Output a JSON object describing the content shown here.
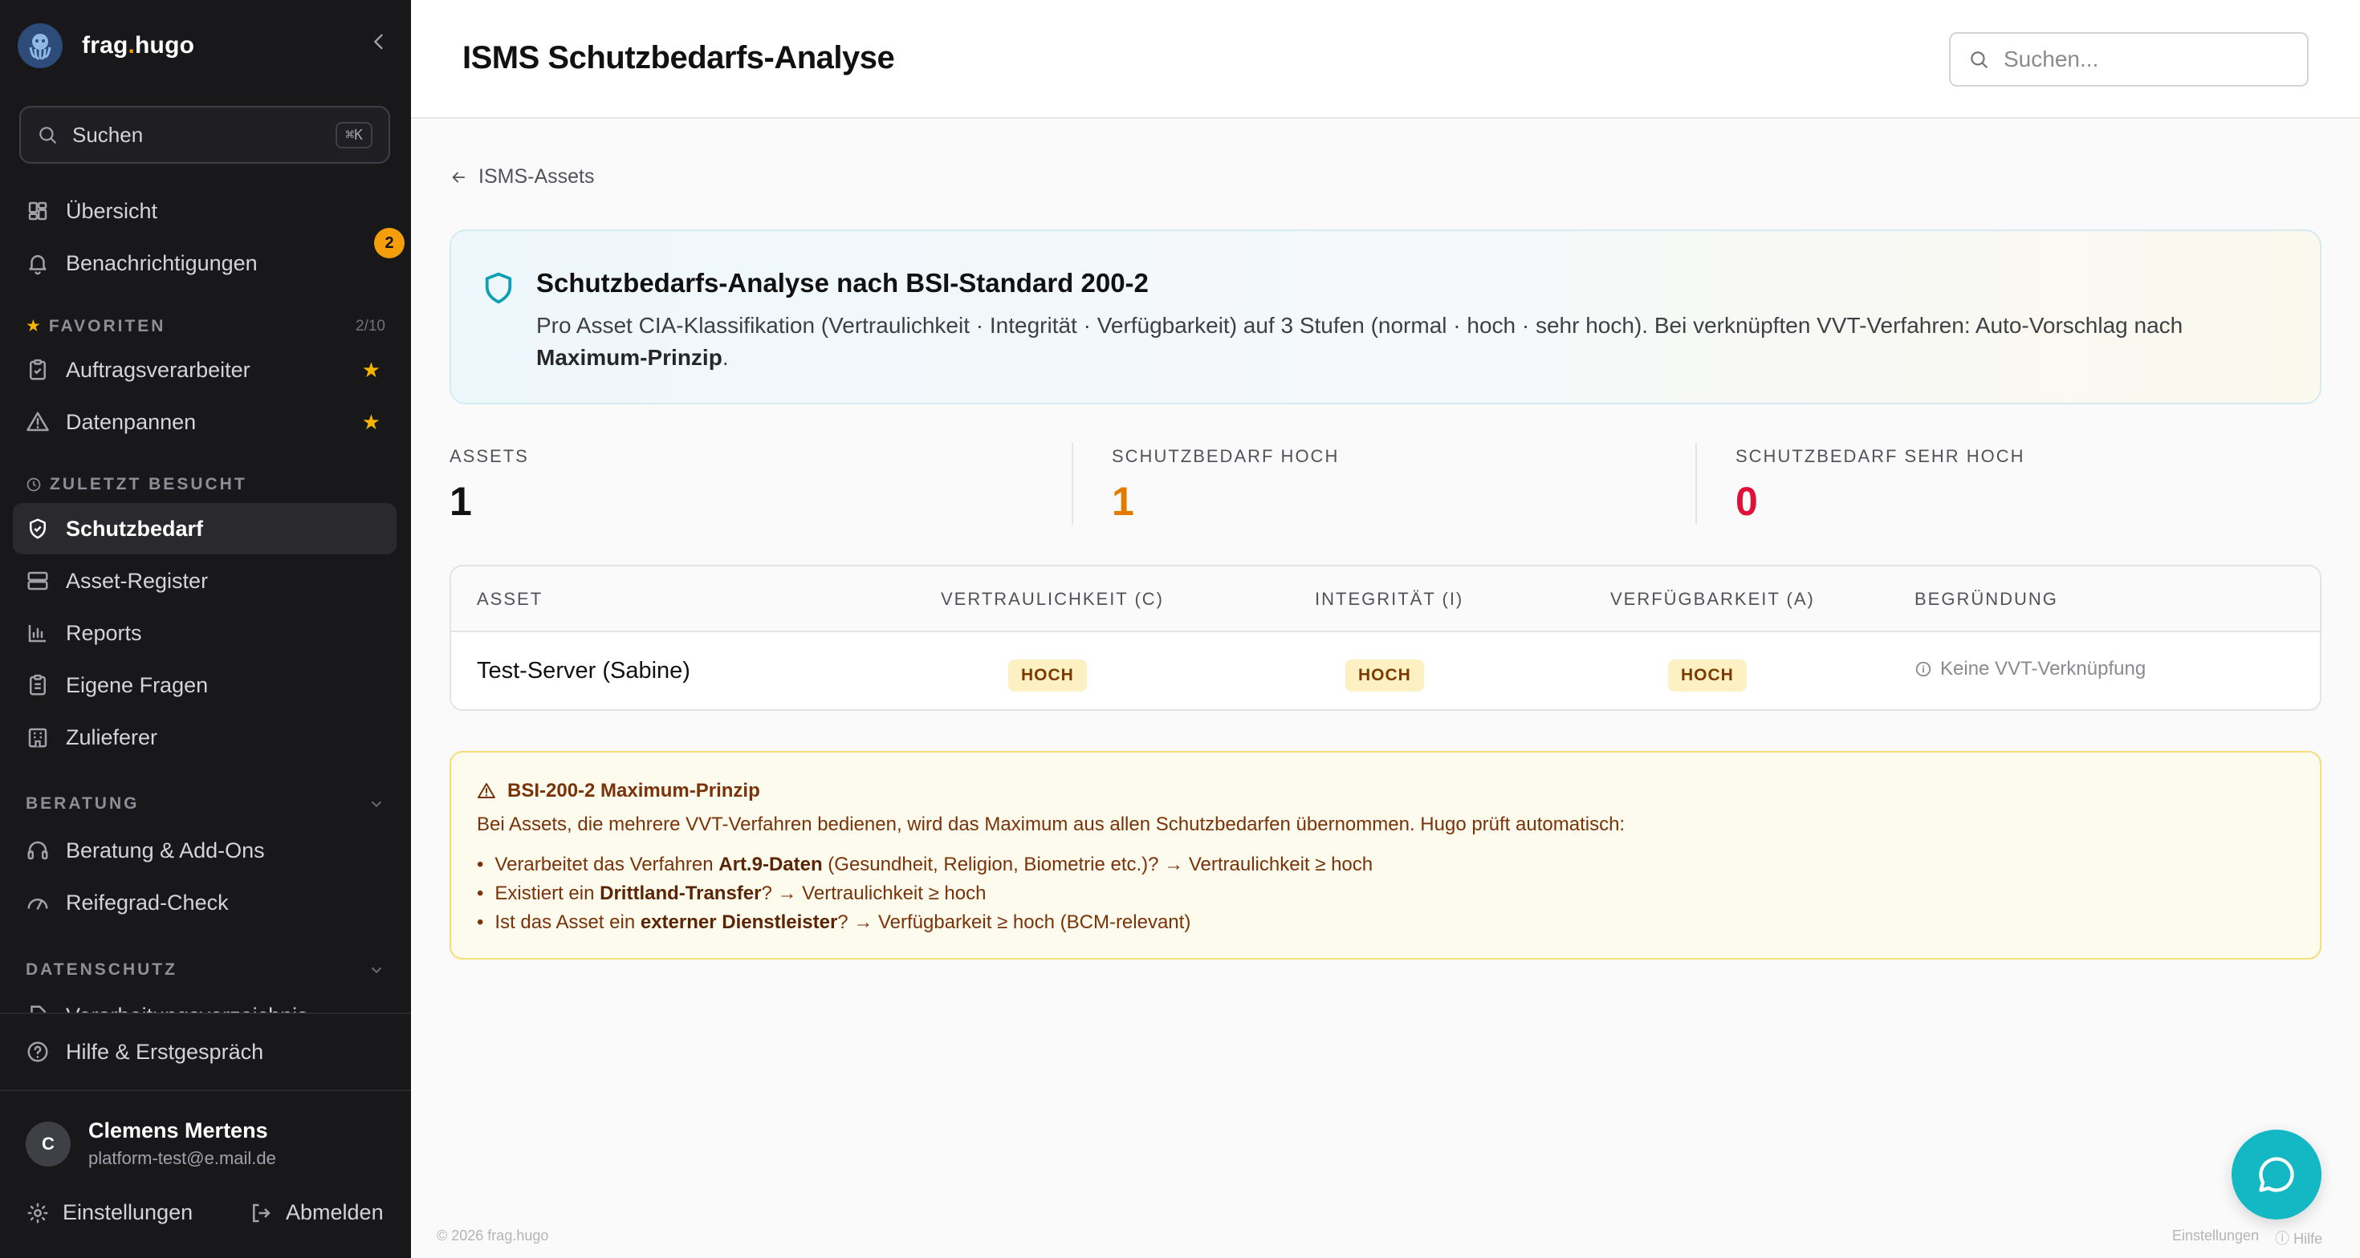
{
  "brand": {
    "name_part1": "frag",
    "dot": ".",
    "name_part2": "hugo"
  },
  "sidebar": {
    "search_label": "Suchen",
    "search_shortcut": "⌘K",
    "overview": "Übersicht",
    "notifications": "Benachrichtigungen",
    "notifications_count": "2",
    "favorites_heading": "FAVORITEN",
    "favorites_count": "2/10",
    "favorites": [
      "Auftragsverarbeiter",
      "Datenpannen"
    ],
    "recent_heading": "ZULETZT BESUCHT",
    "recent": [
      "Schutzbedarf",
      "Asset-Register",
      "Reports",
      "Eigene Fragen",
      "Zulieferer"
    ],
    "beratung_heading": "BERATUNG",
    "beratung": [
      "Beratung & Add-Ons",
      "Reifegrad-Check"
    ],
    "datenschutz_heading": "DATENSCHUTZ",
    "datenschutz_partial": "Verarbeitungsverzeichnis",
    "help": "Hilfe & Erstgespräch",
    "user": {
      "initial": "C",
      "name": "Clemens Mertens",
      "email": "platform-test@e.mail.de"
    },
    "settings": "Einstellungen",
    "logout": "Abmelden"
  },
  "header": {
    "title": "ISMS Schutzbedarfs-Analyse",
    "search_placeholder": "Suchen..."
  },
  "breadcrumb": {
    "back_label": "ISMS-Assets"
  },
  "info": {
    "title": "Schutzbedarfs-Analyse nach BSI-Standard 200-2",
    "text_before": "Pro Asset CIA-Klassifikation (Vertraulichkeit · Integrität · Verfügbarkeit) auf 3 Stufen (normal · hoch · sehr hoch). Bei verknüpften VVT-Verfahren: Auto-Vorschlag nach ",
    "text_bold": "Maximum-Prinzip",
    "text_after": "."
  },
  "stats": [
    {
      "label": "ASSETS",
      "value": "1",
      "color": "#111111"
    },
    {
      "label": "SCHUTZBEDARF HOCH",
      "value": "1",
      "color": "#e07b00"
    },
    {
      "label": "SCHUTZBEDARF SEHR HOCH",
      "value": "0",
      "color": "#e0103a"
    }
  ],
  "table": {
    "headers": [
      "ASSET",
      "VERTRAULICHKEIT (C)",
      "INTEGRITÄT (I)",
      "VERFÜGBARKEIT (A)",
      "BEGRÜNDUNG"
    ],
    "rows": [
      {
        "asset": "Test-Server (Sabine)",
        "c": "HOCH",
        "i": "HOCH",
        "a": "HOCH",
        "reason": "Keine VVT-Verknüpfung"
      }
    ]
  },
  "warning": {
    "title": "BSI-200-2 Maximum-Prinzip",
    "desc": "Bei Assets, die mehrere VVT-Verfahren bedienen, wird das Maximum aus allen Schutzbedarfen übernommen. Hugo prüft automatisch:",
    "items": [
      {
        "pre": "Verarbeitet das Verfahren ",
        "bold": "Art.9-Daten",
        "post": " (Gesundheit, Religion, Biometrie etc.)? → Vertraulichkeit ≥ hoch"
      },
      {
        "pre": "Existiert ein ",
        "bold": "Drittland-Transfer",
        "post": "? → Vertraulichkeit ≥ hoch"
      },
      {
        "pre": "Ist das Asset ein ",
        "bold": "externer Dienstleister",
        "post": "? → Verfügbarkeit ≥ hoch (BCM-relevant)"
      }
    ]
  },
  "footer": {
    "copyright": "© 2026 frag.hugo",
    "settings": "Einstellungen",
    "help": "Hilfe"
  },
  "colors": {
    "accent": "#14b8c4",
    "sidebar_bg": "#18181b",
    "warning_bg": "#fdfaee",
    "pill_bg": "#fdf0c2"
  }
}
